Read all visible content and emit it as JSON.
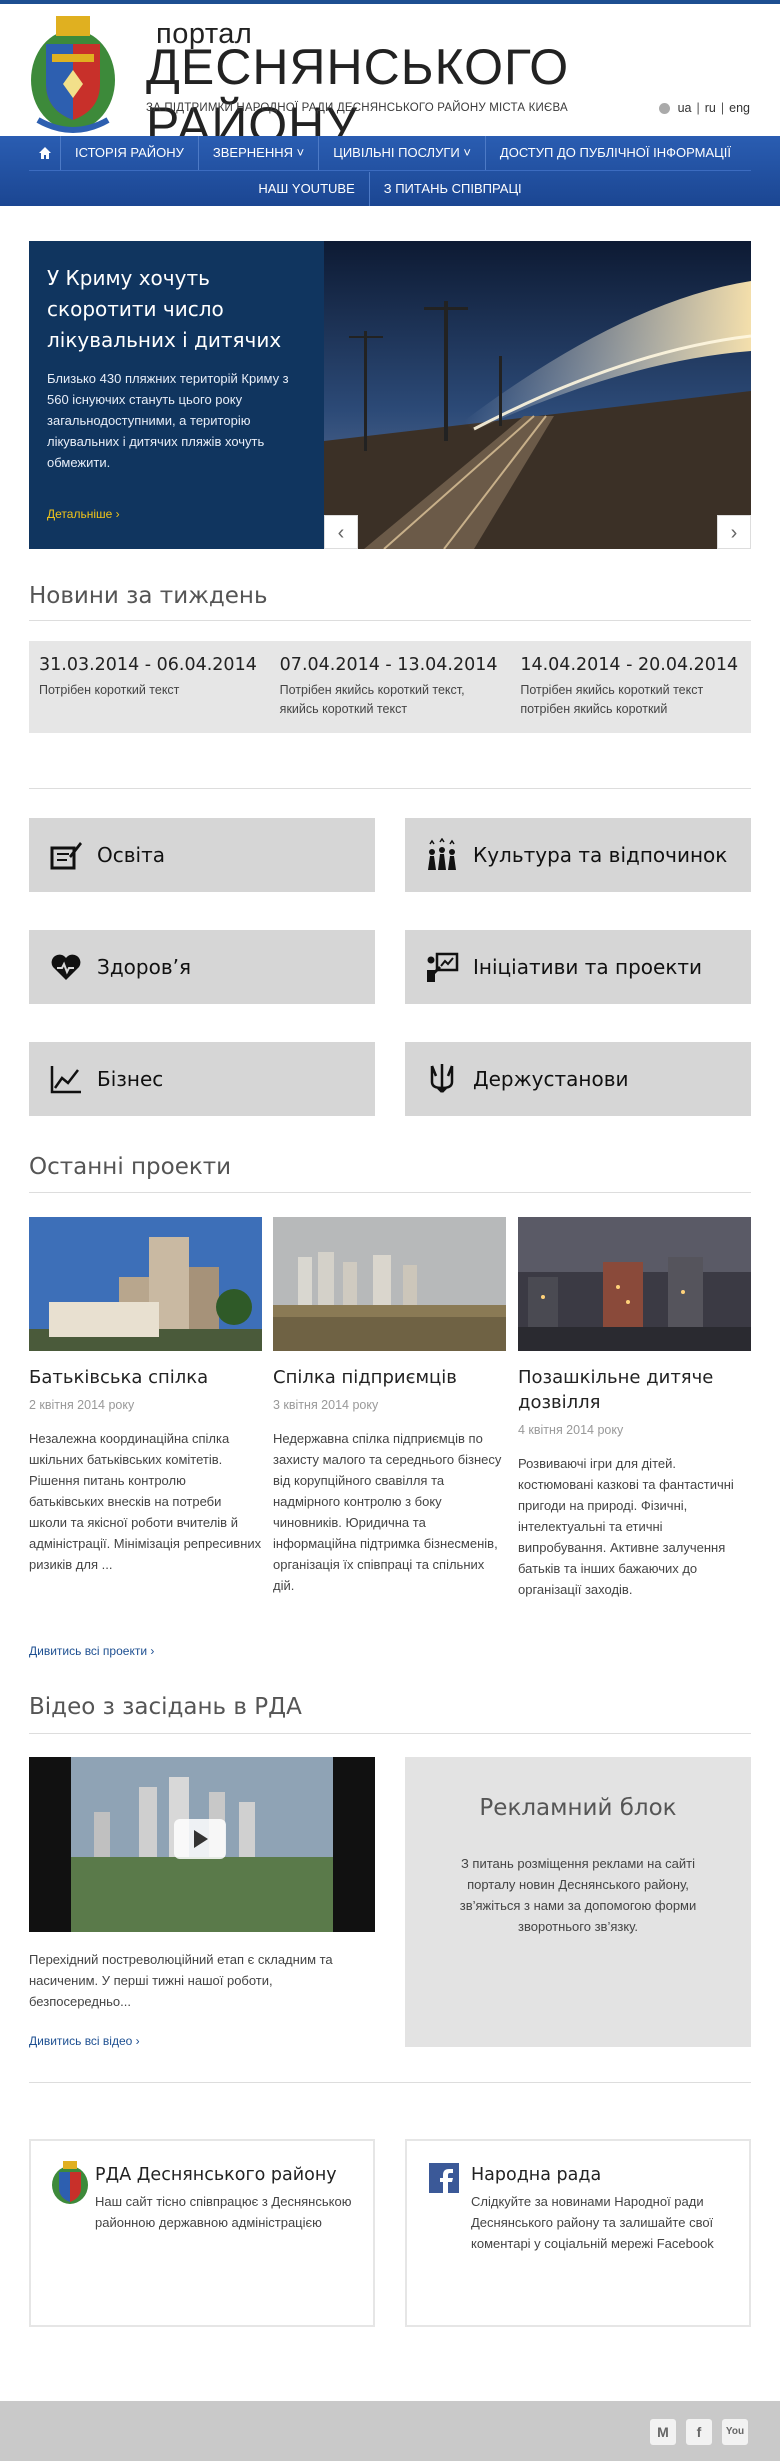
{
  "header": {
    "title_small": "портал",
    "title_big": "ДЕСНЯНСЬКОГО РАЙОНУ",
    "subtitle": "ЗА ПІДТРИМКИ НАРОДНОЇ РАДИ ДЕСНЯНСЬКОГО РАЙОНУ МІСТА КИЄВА",
    "languages": [
      "ua",
      "ru",
      "eng"
    ]
  },
  "nav": {
    "home_icon": "home-icon",
    "row1": [
      "ІСТОРІЯ РАЙОНУ",
      "ЗВЕРНЕННЯ ˅",
      "ЦИВІЛЬНІ ПОСЛУГИ ˅",
      "ДОСТУП ДО ПУБЛІЧНОЇ ІНФОРМАЦІЇ"
    ],
    "row2": [
      "НАШ YOUTUBE",
      "З ПИТАНЬ СПІВПРАЦІ"
    ]
  },
  "slider": {
    "title": "У Криму хочуть скоротити число лікувальних і дитячих",
    "body": "Близько 430 пляжних територій Криму з 560 існуючих стануть цього року загальнодоступними, а територію лікувальних і дитячих пляжів хочуть обмежити.",
    "more": "Детальніше",
    "prev": "‹",
    "next": "›"
  },
  "news": {
    "title": "Новини за тиждень",
    "weeks": [
      {
        "date": "31.03.2014 - 06.04.2014",
        "text": "Потрібен короткий текст"
      },
      {
        "date": "07.04.2014 - 13.04.2014",
        "text": "Потрібен якийсь короткий текст, якийсь короткий текст"
      },
      {
        "date": "14.04.2014 - 20.04.2014",
        "text": "Потрібен якийсь короткий текст потрібен якийсь короткий"
      }
    ]
  },
  "categories": [
    {
      "label": "Освіта",
      "icon": "education-icon"
    },
    {
      "label": "Культура та відпочинок",
      "icon": "culture-icon"
    },
    {
      "label": "Здоров’я",
      "icon": "heart-icon"
    },
    {
      "label": "Ініціативи та проекти",
      "icon": "presentation-icon"
    },
    {
      "label": "Бізнес",
      "icon": "chart-icon"
    },
    {
      "label": "Держустанови",
      "icon": "trident-icon"
    }
  ],
  "projects": {
    "title": "Останні проекти",
    "items": [
      {
        "title": "Батьківська спілка",
        "date": "2 квітня 2014 року",
        "body": "Незалежна координаційна спілка шкільних батьківських комітетів. Рішення питань контролю батьківських внесків на потреби школи та якісної роботи вчителів й адміністрації. Мінімізація репресивних ризиків для ..."
      },
      {
        "title": "Спілка підприємців",
        "date": "3 квітня 2014 року",
        "body": "Недержавна спілка підприємців по захисту малого та середнього бізнесу від корупційного свавілля та надмірного контролю з боку чиновників. Юридична та інформаційна підтримка бізнесменів, організація їх співпраці та спільних дій."
      },
      {
        "title": "Позашкільне дитяче дозвілля",
        "date": "4 квітня 2014 року",
        "body": "Розвиваючі ігри для дітей. костюмовані казкові та фантастичні пригоди на природі. Фізичні, інтелектуальні та етичні випробування. Активне залучення батьків та інших бажаючих до організації заходів."
      }
    ],
    "more": "Дивитись всі проекти"
  },
  "videos": {
    "title": "Відео з засідань в РДА",
    "caption": "Перехідний постреволюційний етап є складним та насиченим. У перші тижні нашої роботи, безпосередньо...",
    "more": "Дивитись всі відео"
  },
  "ad": {
    "title": "Рекламний блок",
    "body": "З питань розміщення реклами на сайті порталу новин Деснянського району, зв’яжіться з нами за допомогою форми зворотнього зв’язку."
  },
  "partners": [
    {
      "title": "РДА Деснянського району",
      "body": "Наш сайт тісно співпрацює з Деснянською районною державною адміністрацією",
      "icon": "coat-of-arms-icon"
    },
    {
      "title": "Народна рада",
      "body": "Слідкуйте за новинами Народної ради Деснянського району та залишайте свої коментарі у соціальній мережі Facebook",
      "icon": "facebook-icon"
    }
  ],
  "footer": {
    "social": [
      {
        "icon": "gmail-icon",
        "glyph": "M"
      },
      {
        "icon": "facebook-icon",
        "glyph": "f"
      },
      {
        "icon": "youtube-icon",
        "glyph": "You"
      }
    ]
  },
  "colors": {
    "nav": "#1b4692",
    "slide_panel": "#10355f",
    "link": "#1d4f91",
    "more_link": "#f0c419",
    "tile": "#d6d6d6"
  }
}
